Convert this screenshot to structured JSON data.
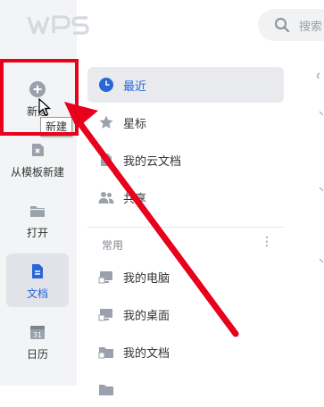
{
  "app": {
    "logo_text": "WPS"
  },
  "search": {
    "placeholder": "搜索"
  },
  "sidebar": {
    "items": [
      {
        "label": "新建",
        "icon": "plus-circle-icon"
      },
      {
        "label": "从模板新建",
        "icon": "template-icon"
      },
      {
        "label": "打开",
        "icon": "folder-icon"
      },
      {
        "label": "文档",
        "icon": "document-icon"
      },
      {
        "label": "日历",
        "icon": "calendar-icon"
      }
    ],
    "tooltip": "新建"
  },
  "panel": {
    "items": [
      {
        "label": "最近",
        "icon": "clock-icon"
      },
      {
        "label": "星标",
        "icon": "star-icon"
      },
      {
        "label": "我的云文档",
        "icon": "cloud-doc-icon"
      },
      {
        "label": "共享",
        "icon": "people-icon"
      }
    ],
    "section_title": "常用",
    "section_more": "⋮",
    "common": [
      {
        "label": "我的电脑",
        "icon": "computer-icon"
      },
      {
        "label": "我的桌面",
        "icon": "desktop-icon"
      },
      {
        "label": "我的文档",
        "icon": "folder-icon"
      }
    ]
  },
  "colors": {
    "accent": "#2b66d9",
    "annotation": "#e8001c"
  }
}
